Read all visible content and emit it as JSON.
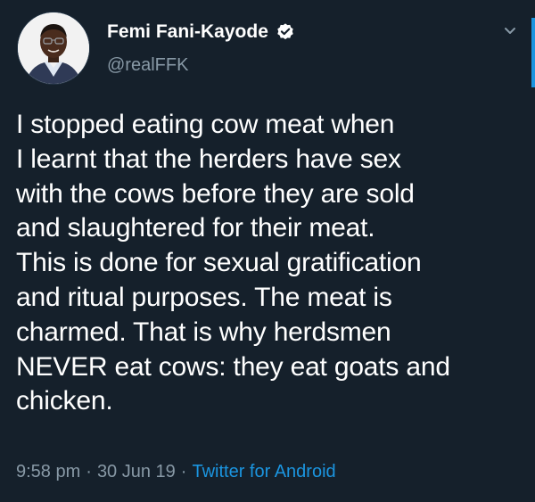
{
  "author": {
    "display_name": "Femi Fani-Kayode",
    "handle": "@realFFK",
    "verified": true,
    "avatar_icon": "profile-photo"
  },
  "tweet": {
    "lines": [
      "I stopped eating cow meat when",
      "I learnt that the herders have sex",
      "with the cows before they are sold",
      "and slaughtered for their meat.",
      "This is done for sexual gratification",
      "and ritual purposes. The meat is",
      "charmed. That is why herdsmen",
      "NEVER eat cows: they eat goats and",
      "chicken."
    ],
    "time": "9:58 pm",
    "date": "30 Jun 19",
    "source": "Twitter for Android",
    "separator": "·"
  },
  "icons": {
    "verified": "verified-badge-icon",
    "menu": "chevron-down-icon"
  },
  "colors": {
    "background": "#15202b",
    "text": "#ffffff",
    "secondary_text": "#8899a6",
    "link": "#1b95e0"
  }
}
